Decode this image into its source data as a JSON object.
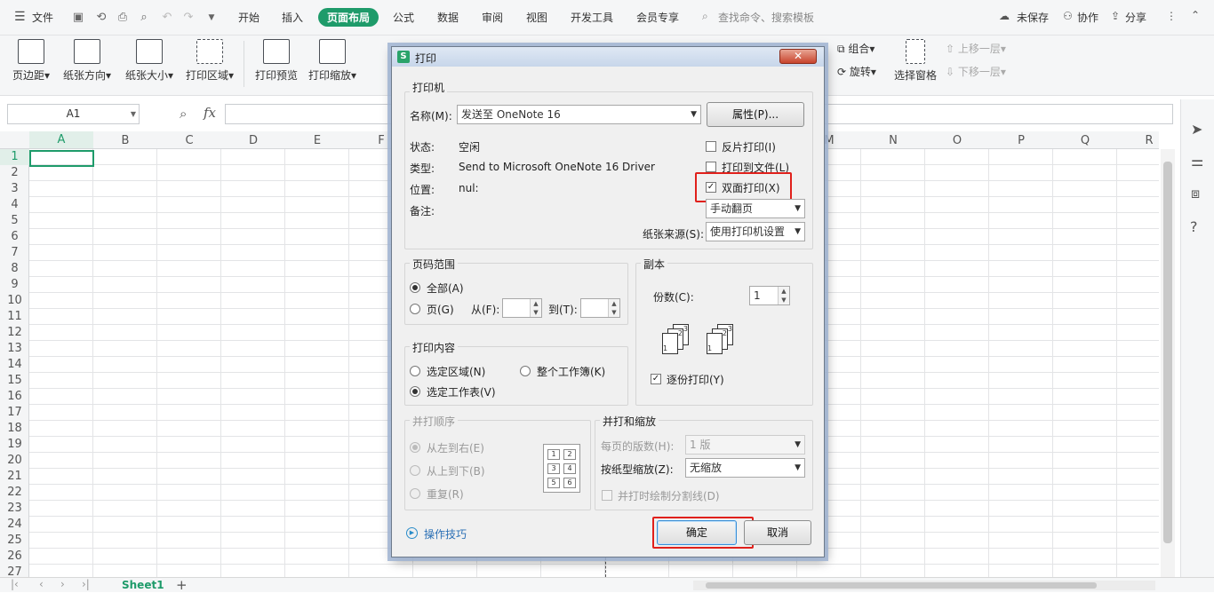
{
  "menubar": {
    "file": "文件",
    "tabs": [
      "开始",
      "插入",
      "页面布局",
      "公式",
      "数据",
      "审阅",
      "视图",
      "开发工具",
      "会员专享"
    ],
    "search": "查找命令、搜索模板",
    "unsaved": "未保存",
    "collab": "协作",
    "share": "分享"
  },
  "ribbon": {
    "margin": "页边距",
    "orientation": "纸张方向",
    "size": "纸张大小",
    "print_area": "打印区域",
    "print_preview": "打印预览",
    "print_scale": "打印缩放",
    "group": "组合",
    "rotate": "旋转",
    "select_pane": "选择窗格",
    "bring_forward": "上移一层",
    "send_backward": "下移一层"
  },
  "formula": {
    "cell_ref": "A1",
    "fx": "fx"
  },
  "columns": [
    "A",
    "B",
    "C",
    "D",
    "E",
    "F",
    "",
    "",
    "",
    "",
    "",
    "",
    "M",
    "N",
    "O",
    "P",
    "Q",
    "R"
  ],
  "rows": [
    "1",
    "2",
    "3",
    "4",
    "5",
    "6",
    "7",
    "8",
    "9",
    "10",
    "11",
    "12",
    "13",
    "14",
    "15",
    "16",
    "17",
    "18",
    "19",
    "20",
    "21",
    "22",
    "23",
    "24",
    "25",
    "26",
    "27"
  ],
  "sheet": {
    "tab": "Sheet1",
    "add": "+"
  },
  "dialog": {
    "title": "打印",
    "printer": {
      "group": "打印机",
      "name_label": "名称(M):",
      "name_value": "发送至 OneNote 16",
      "properties": "属性(P)...",
      "status_label": "状态:",
      "status_value": "空闲",
      "type_label": "类型:",
      "type_value": "Send to Microsoft OneNote 16 Driver",
      "location_label": "位置:",
      "location_value": "nul:",
      "comment_label": "备注:",
      "reverse": "反片打印(I)",
      "to_file": "打印到文件(L)",
      "duplex": "双面打印(X)",
      "duplex_mode": "手动翻页",
      "source_label": "纸张来源(S):",
      "source_value": "使用打印机设置"
    },
    "range": {
      "group": "页码范围",
      "all": "全部(A)",
      "pages": "页(G)",
      "from": "从(F):",
      "to": "到(T):"
    },
    "copies": {
      "group": "副本",
      "count_label": "份数(C):",
      "count_value": "1",
      "collate": "逐份打印(Y)"
    },
    "content": {
      "group": "打印内容",
      "selection": "选定区域(N)",
      "workbook": "整个工作簿(K)",
      "sheet": "选定工作表(V)"
    },
    "order": {
      "group": "并打顺序",
      "ltr": "从左到右(E)",
      "ttb": "从上到下(B)",
      "repeat": "重复(R)",
      "grid": [
        "1",
        "2",
        "3",
        "4",
        "5",
        "6"
      ]
    },
    "scale": {
      "group": "并打和缩放",
      "per_page_label": "每页的版数(H):",
      "per_page_value": "1 版",
      "paper_label": "按纸型缩放(Z):",
      "paper_value": "无缩放",
      "divider": "并打时绘制分割线(D)"
    },
    "tips": "操作技巧",
    "ok": "确定",
    "cancel": "取消"
  },
  "colors": {
    "accent": "#1e9b6a",
    "highlight": "#e0201b"
  }
}
